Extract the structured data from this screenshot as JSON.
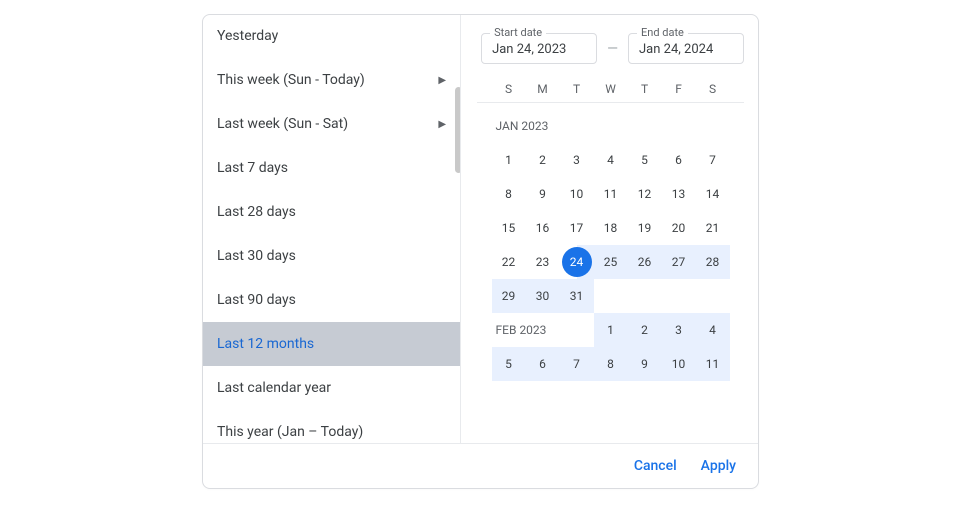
{
  "presets": [
    {
      "label": "Yesterday",
      "arrow": false
    },
    {
      "label": "This week (Sun - Today)",
      "arrow": true
    },
    {
      "label": "Last week (Sun - Sat)",
      "arrow": true
    },
    {
      "label": "Last 7 days",
      "arrow": false
    },
    {
      "label": "Last 28 days",
      "arrow": false
    },
    {
      "label": "Last 30 days",
      "arrow": false
    },
    {
      "label": "Last 90 days",
      "arrow": false
    },
    {
      "label": "Last 12 months",
      "arrow": false,
      "selected": true
    },
    {
      "label": "Last calendar year",
      "arrow": false
    },
    {
      "label": "This year (Jan – Today)",
      "arrow": false
    }
  ],
  "startDate": {
    "legend": "Start date",
    "value": "Jan 24, 2023"
  },
  "endDate": {
    "legend": "End date",
    "value": "Jan 24, 2024"
  },
  "separator": "—",
  "weekdays": [
    "S",
    "M",
    "T",
    "W",
    "T",
    "F",
    "S"
  ],
  "months": [
    {
      "label": "JAN 2023",
      "padStart": 0,
      "days": 31,
      "rangeFrom": 24,
      "selectedStart": 24
    },
    {
      "label": "FEB 2023",
      "headShare": true,
      "padStart": 3,
      "days": 11,
      "rangeFrom": 1
    }
  ],
  "actions": {
    "cancel": "Cancel",
    "apply": "Apply"
  }
}
